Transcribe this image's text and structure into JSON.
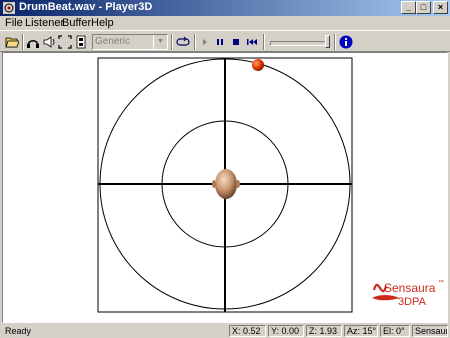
{
  "window": {
    "title": "DrumBeat.wav - Player3D",
    "controls": {
      "minimize": "_",
      "maximize": "□",
      "close": "×"
    }
  },
  "menu": {
    "file": "File",
    "listener": "Listener",
    "buffer": "Buffer",
    "help": "Help"
  },
  "toolbar": {
    "environment_select": {
      "value": "Generic",
      "disabled": true
    },
    "icons": [
      "open-folder-icon",
      "listener-head-icon",
      "speaker-icon",
      "fullscreen-icon",
      "buffer-icon",
      "loop-icon",
      "play-icon",
      "pause-icon",
      "stop-icon",
      "rewind-icon",
      "info-icon"
    ],
    "volume_level": 1.0
  },
  "scene": {
    "source_color": "#e53d00",
    "listener_color": "#c4906a"
  },
  "logo": {
    "brand": "Sensaura",
    "trademark": "™",
    "product": "3DPA",
    "color": "#cc2a1d"
  },
  "status": {
    "state": "Ready",
    "x": "X:  0.52",
    "y": "Y:  0.00",
    "z": "Z:  1.93",
    "az": "Az:   15°",
    "el": "El:   0°",
    "brand": "Sensaura"
  }
}
